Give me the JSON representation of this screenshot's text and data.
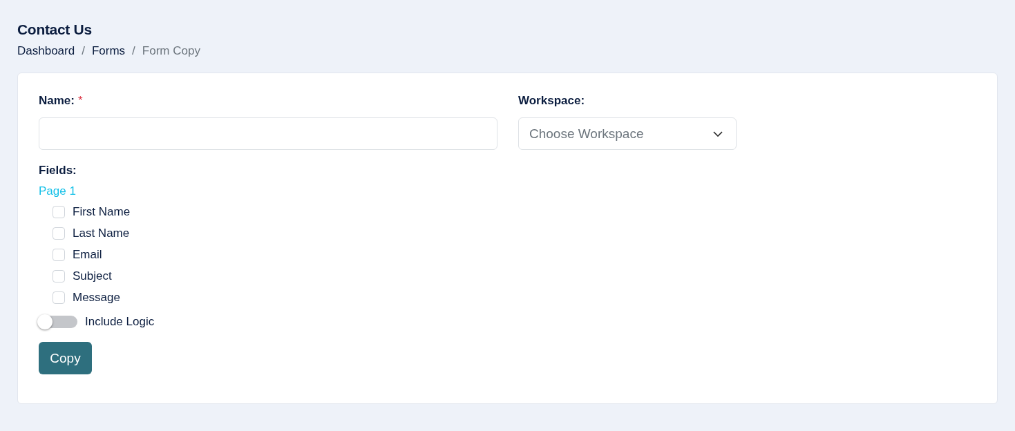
{
  "page": {
    "title": "Contact Us"
  },
  "breadcrumb": [
    {
      "label": "Dashboard",
      "kind": "link"
    },
    {
      "label": "/",
      "kind": "separator"
    },
    {
      "label": "Forms",
      "kind": "link"
    },
    {
      "label": "/",
      "kind": "separator"
    },
    {
      "label": "Form Copy",
      "kind": "current"
    }
  ],
  "form": {
    "name_field": {
      "label": "Name:",
      "required_mark": "*"
    },
    "workspace_field": {
      "label": "Workspace:",
      "placeholder": "Choose Workspace"
    },
    "fields": {
      "label": "Fields:",
      "pages": [
        {
          "title": "Page 1",
          "items": [
            {
              "label": "First Name",
              "checked": false
            },
            {
              "label": "Last Name",
              "checked": false
            },
            {
              "label": "Email",
              "checked": false
            },
            {
              "label": "Subject",
              "checked": false
            },
            {
              "label": "Message",
              "checked": false
            }
          ]
        }
      ]
    },
    "include_logic": {
      "label": "Include Logic",
      "on": false
    },
    "submit": {
      "label": "Copy"
    }
  }
}
